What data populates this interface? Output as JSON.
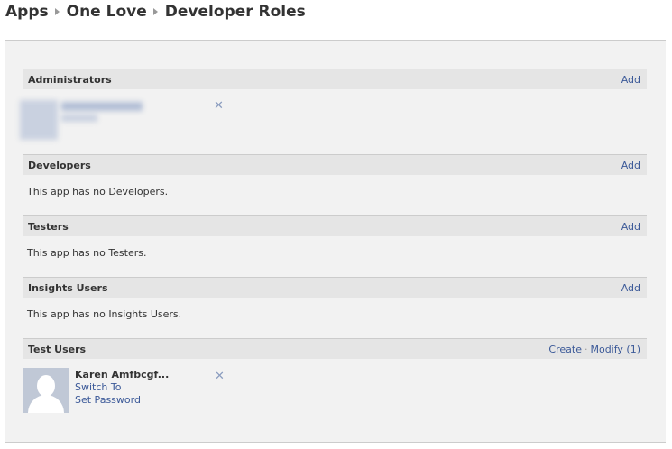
{
  "breadcrumb": {
    "items": [
      "Apps",
      "One Love",
      "Developer Roles"
    ]
  },
  "sections": {
    "administrators": {
      "title": "Administrators",
      "action": "Add"
    },
    "developers": {
      "title": "Developers",
      "action": "Add",
      "empty": "This app has no Developers."
    },
    "testers": {
      "title": "Testers",
      "action": "Add",
      "empty": "This app has no Testers."
    },
    "insights": {
      "title": "Insights Users",
      "action": "Add",
      "empty": "This app has no Insights Users."
    },
    "test_users": {
      "title": "Test Users",
      "create_label": "Create",
      "separator": "·",
      "modify_label": "Modify (1)",
      "user": {
        "name": "Karen Amfbcgf...",
        "switch_label": "Switch To",
        "password_label": "Set Password"
      }
    }
  },
  "icons": {
    "remove": "close-icon",
    "separator": "triangle-right-icon"
  },
  "colors": {
    "link": "#3b5998",
    "header_bg": "#e5e5e5",
    "panel_bg": "#f2f2f2"
  }
}
